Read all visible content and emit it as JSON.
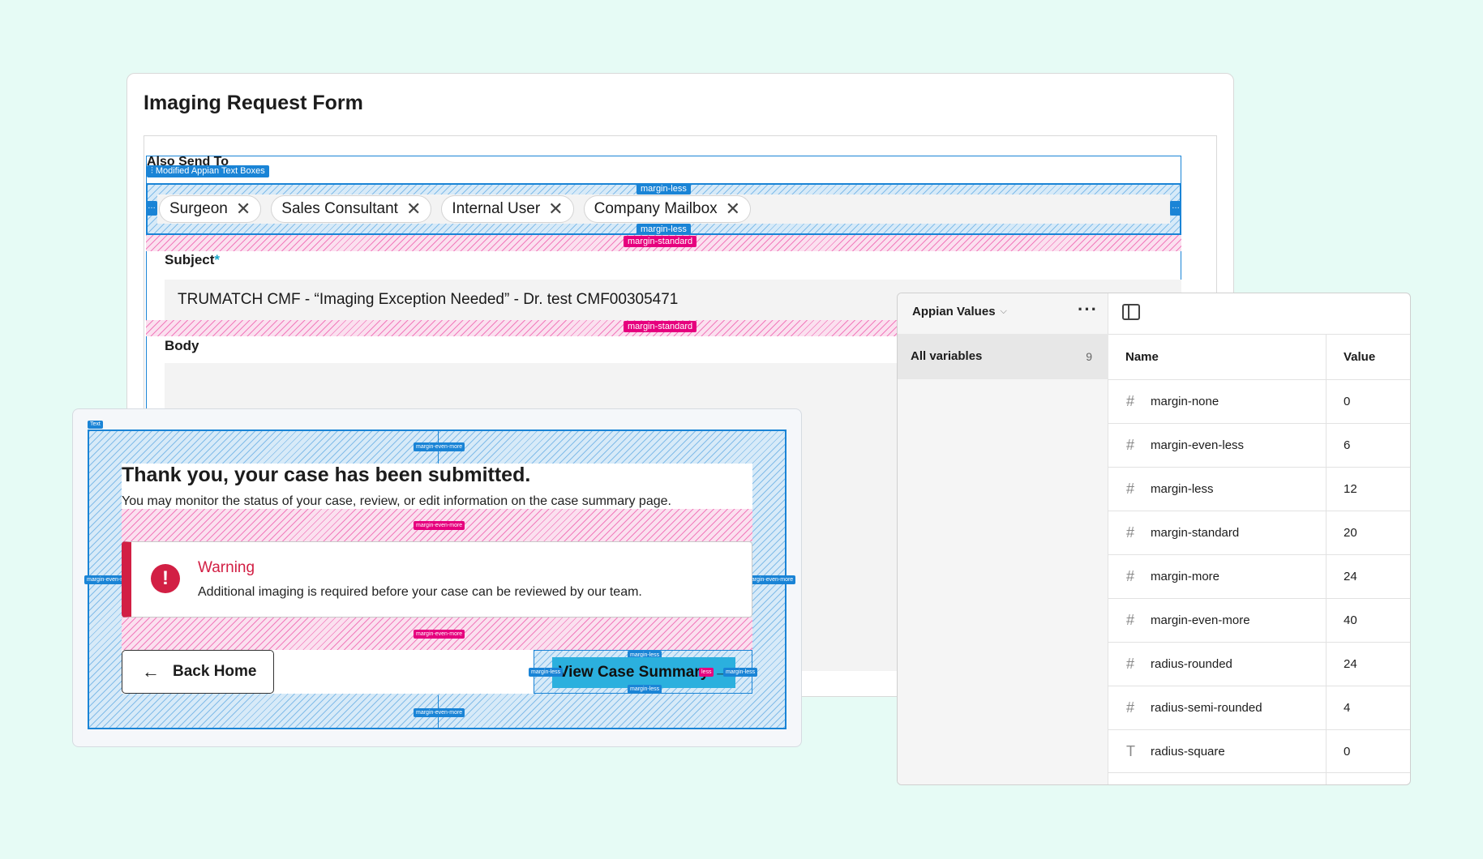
{
  "form": {
    "title": "Imaging Request Form",
    "also_send_label": "Also Send To",
    "modified_tag": "Modified Appian Text Boxes",
    "chips": [
      "Surgeon",
      "Sales Consultant",
      "Internal User",
      "Company Mailbox"
    ],
    "subject_label": "Subject",
    "subject_required": "*",
    "subject_value": "TRUMATCH CMF - “Imaging Exception Needed” - Dr. test CMF00305471",
    "body_label": "Body"
  },
  "spacing_tags": {
    "margin_less": "margin-less",
    "margin_standard": "margin-standard",
    "margin_even_more": "margin-even-more",
    "text_tag": "Text",
    "less_short": "less"
  },
  "confirmation": {
    "title": "Thank you, your case has been submitted.",
    "description": "You may monitor the status of your case, review, or edit information on the case summary page.",
    "warning_title": "Warning",
    "warning_text": "Additional imaging is required before your case can be reviewed by our team.",
    "back_button": "Back Home",
    "view_button": "View Case Summary"
  },
  "variables_panel": {
    "title": "Appian Values",
    "filter_label": "All variables",
    "filter_count": "9",
    "col_name": "Name",
    "col_value": "Value",
    "rows": [
      {
        "icon": "#",
        "name": "margin-none",
        "value": "0"
      },
      {
        "icon": "#",
        "name": "margin-even-less",
        "value": "6"
      },
      {
        "icon": "#",
        "name": "margin-less",
        "value": "12"
      },
      {
        "icon": "#",
        "name": "margin-standard",
        "value": "20"
      },
      {
        "icon": "#",
        "name": "margin-more",
        "value": "24"
      },
      {
        "icon": "#",
        "name": "margin-even-more",
        "value": "40"
      },
      {
        "icon": "#",
        "name": "radius-rounded",
        "value": "24"
      },
      {
        "icon": "#",
        "name": "radius-semi-rounded",
        "value": "4"
      },
      {
        "icon": "T",
        "name": "radius-square",
        "value": "0"
      }
    ]
  },
  "colors": {
    "background": "#e6fbf5",
    "selection_blue": "#1a84d6",
    "margin_pink": "#e6007e",
    "warning_red": "#d21f44",
    "primary_button": "#2bb0de"
  }
}
